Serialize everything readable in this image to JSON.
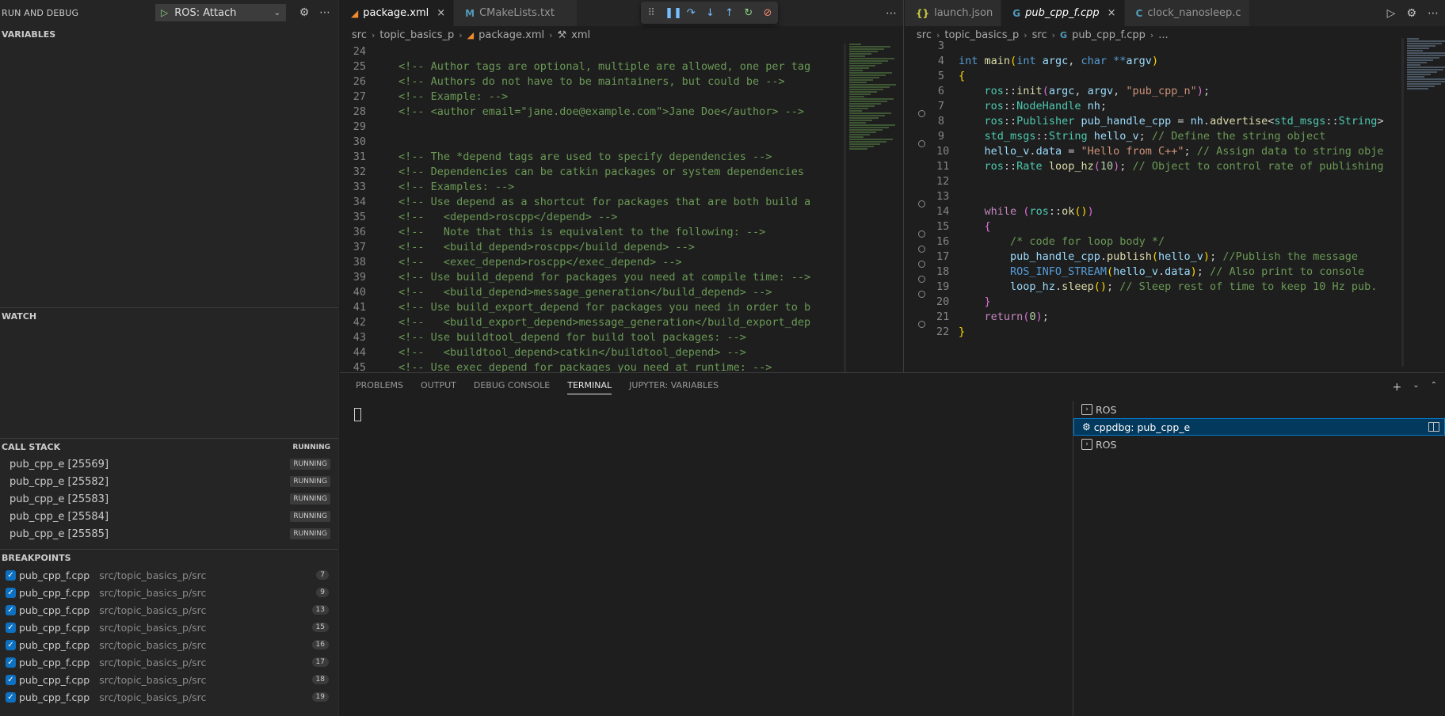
{
  "sidebar": {
    "title": "RUN AND DEBUG",
    "config": "ROS: Attach",
    "variables_title": "VARIABLES",
    "watch_title": "WATCH",
    "callstack_title": "CALL STACK",
    "callstack_status": "RUNNING",
    "callstack": [
      {
        "name": "pub_cpp_e [25569]",
        "status": "RUNNING"
      },
      {
        "name": "pub_cpp_e [25582]",
        "status": "RUNNING"
      },
      {
        "name": "pub_cpp_e [25583]",
        "status": "RUNNING"
      },
      {
        "name": "pub_cpp_e [25584]",
        "status": "RUNNING"
      },
      {
        "name": "pub_cpp_e [25585]",
        "status": "RUNNING"
      }
    ],
    "breakpoints_title": "BREAKPOINTS",
    "breakpoints": [
      {
        "file": "pub_cpp_f.cpp",
        "path": "src/topic_basics_p/src",
        "line": "7"
      },
      {
        "file": "pub_cpp_f.cpp",
        "path": "src/topic_basics_p/src",
        "line": "9"
      },
      {
        "file": "pub_cpp_f.cpp",
        "path": "src/topic_basics_p/src",
        "line": "13"
      },
      {
        "file": "pub_cpp_f.cpp",
        "path": "src/topic_basics_p/src",
        "line": "15"
      },
      {
        "file": "pub_cpp_f.cpp",
        "path": "src/topic_basics_p/src",
        "line": "16"
      },
      {
        "file": "pub_cpp_f.cpp",
        "path": "src/topic_basics_p/src",
        "line": "17"
      },
      {
        "file": "pub_cpp_f.cpp",
        "path": "src/topic_basics_p/src",
        "line": "18"
      },
      {
        "file": "pub_cpp_f.cpp",
        "path": "src/topic_basics_p/src",
        "line": "19"
      }
    ]
  },
  "left_editor": {
    "tabs": [
      {
        "label": "package.xml",
        "icon": "rss-icon",
        "active": true
      },
      {
        "label": "CMakeLists.txt",
        "icon": "m-icon",
        "active": false
      }
    ],
    "breadcrumb": [
      "src",
      "topic_basics_p",
      "package.xml",
      "xml"
    ],
    "lines": [
      {
        "n": "24",
        "t": ""
      },
      {
        "n": "25",
        "t": "<!-- Author tags are optional, multiple are allowed, one per tag"
      },
      {
        "n": "26",
        "t": "<!-- Authors do not have to be maintainers, but could be -->"
      },
      {
        "n": "27",
        "t": "<!-- Example: -->"
      },
      {
        "n": "28",
        "t": "<!-- <author email=\"jane.doe@example.com\">Jane Doe</author> -->"
      },
      {
        "n": "29",
        "t": ""
      },
      {
        "n": "30",
        "t": ""
      },
      {
        "n": "31",
        "t": "<!-- The *depend tags are used to specify dependencies -->"
      },
      {
        "n": "32",
        "t": "<!-- Dependencies can be catkin packages or system dependencies"
      },
      {
        "n": "33",
        "t": "<!-- Examples: -->"
      },
      {
        "n": "34",
        "t": "<!-- Use depend as a shortcut for packages that are both build a"
      },
      {
        "n": "35",
        "t": "<!--   <depend>roscpp</depend> -->"
      },
      {
        "n": "36",
        "t": "<!--   Note that this is equivalent to the following: -->"
      },
      {
        "n": "37",
        "t": "<!--   <build_depend>roscpp</build_depend> -->"
      },
      {
        "n": "38",
        "t": "<!--   <exec_depend>roscpp</exec_depend> -->"
      },
      {
        "n": "39",
        "t": "<!-- Use build_depend for packages you need at compile time: -->"
      },
      {
        "n": "40",
        "t": "<!--   <build_depend>message_generation</build_depend> -->"
      },
      {
        "n": "41",
        "t": "<!-- Use build_export_depend for packages you need in order to b"
      },
      {
        "n": "42",
        "t": "<!--   <build_export_depend>message_generation</build_export_dep"
      },
      {
        "n": "43",
        "t": "<!-- Use buildtool_depend for build tool packages: -->"
      },
      {
        "n": "44",
        "t": "<!--   <buildtool_depend>catkin</buildtool_depend> -->"
      },
      {
        "n": "45",
        "t": "<!-- Use exec_depend for packages you need at runtime: -->"
      }
    ]
  },
  "right_editor": {
    "tabs": [
      {
        "label": "launch.json",
        "icon": "braces-icon",
        "active": false
      },
      {
        "label": "pub_cpp_f.cpp",
        "icon": "cpp-icon",
        "active": true
      },
      {
        "label": "clock_nanosleep.c",
        "icon": "c-icon",
        "active": false
      }
    ],
    "breadcrumb": [
      "src",
      "topic_basics_p",
      "src",
      "pub_cpp_f.cpp",
      "..."
    ],
    "line_numbers": [
      "3",
      "4",
      "5",
      "6",
      "7",
      "8",
      "9",
      "10",
      "11",
      "12",
      "13",
      "14",
      "15",
      "16",
      "17",
      "18",
      "19",
      "20",
      "21",
      "22"
    ],
    "breakpoint_lines": [
      "7",
      "9",
      "13",
      "15",
      "16",
      "17",
      "18",
      "19",
      "21"
    ]
  },
  "debug_toolbar": [
    "grip-icon",
    "pause-icon",
    "step-over-icon",
    "step-into-icon",
    "step-out-icon",
    "restart-icon",
    "disconnect-icon"
  ],
  "panel": {
    "tabs": [
      "PROBLEMS",
      "OUTPUT",
      "DEBUG CONSOLE",
      "TERMINAL",
      "JUPYTER: VARIABLES"
    ],
    "active_tab": "TERMINAL",
    "terminals": [
      {
        "label": "ROS",
        "icon": "terminal-icon",
        "selected": false
      },
      {
        "label": "cppdbg: pub_cpp_e",
        "icon": "debug-icon",
        "selected": true
      },
      {
        "label": "ROS",
        "icon": "terminal-icon",
        "selected": false
      }
    ]
  },
  "colors": {
    "accent": "#007fd4",
    "comment": "#6a9955",
    "keyword": "#569cd6",
    "type": "#4ec9b0"
  }
}
